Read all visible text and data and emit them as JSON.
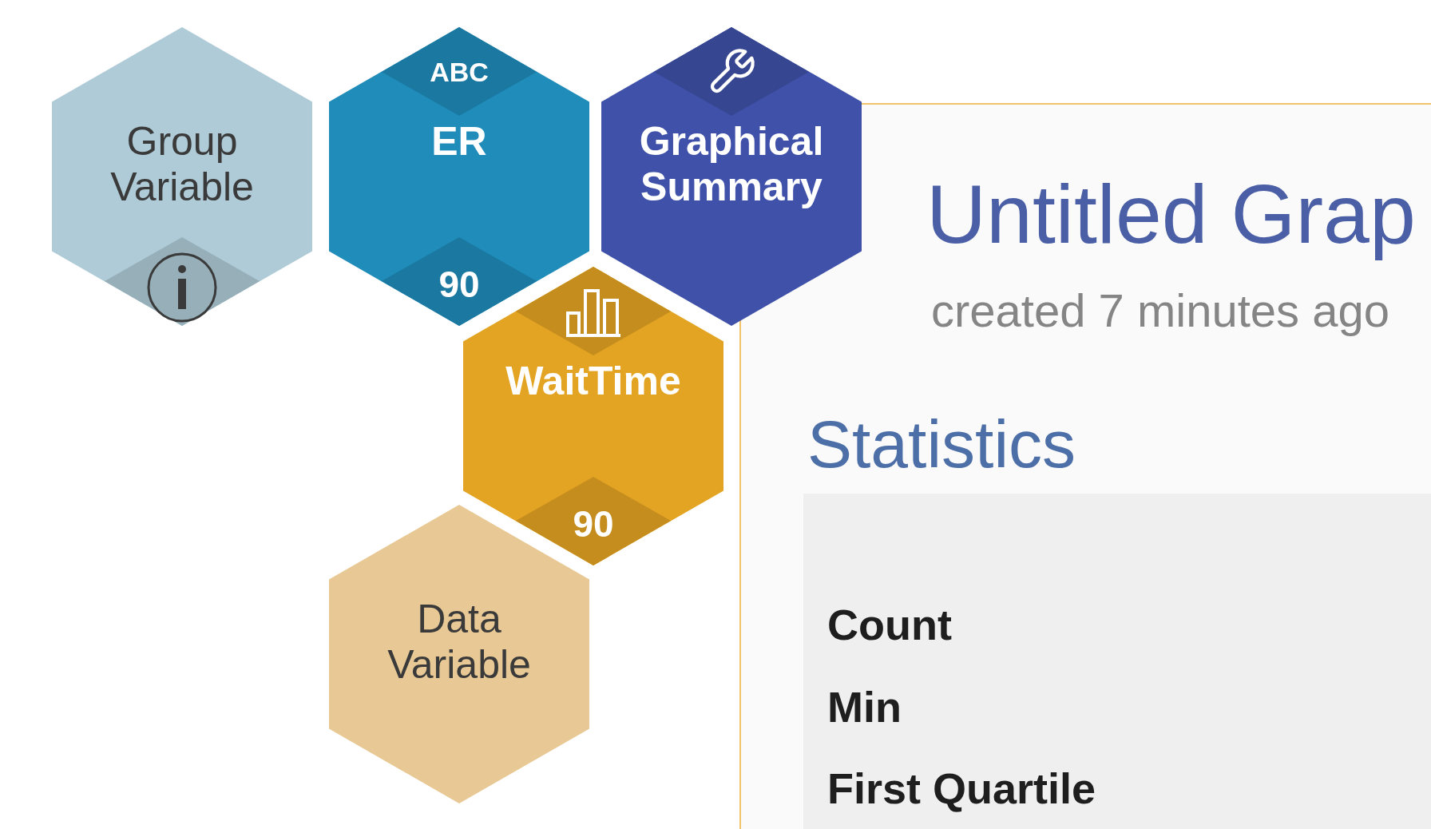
{
  "tiles": [
    {
      "label": "Group Variable",
      "color": "#aecbd7",
      "bottom": {
        "kind": "info"
      }
    },
    {
      "label": "ER",
      "color": "#1f8cba",
      "top": {
        "kind": "text",
        "text": "ABC"
      },
      "bottom": {
        "kind": "text",
        "text": "90"
      }
    },
    {
      "label": "Graphical Summary",
      "color": "#3f51a9",
      "top": {
        "kind": "wrench"
      }
    },
    {
      "label": "WaitTime",
      "color": "#e4a423",
      "top": {
        "kind": "chart"
      },
      "bottom": {
        "kind": "text",
        "text": "90"
      }
    },
    {
      "label": "Data Variable",
      "color": "#e8c995"
    }
  ],
  "panel": {
    "title": "Untitled Grap",
    "subtitle": "created 7 minutes ago",
    "section_title": "Statistics",
    "rows": [
      "Count",
      "Min",
      "First Quartile"
    ]
  }
}
